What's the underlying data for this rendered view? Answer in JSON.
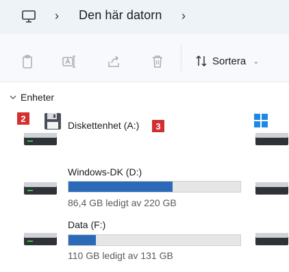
{
  "address": {
    "crumbs": [
      "Den här datorn"
    ],
    "separator": "›"
  },
  "toolbar": {
    "sort_label": "Sortera",
    "buttons": [
      "copy-icon",
      "rename-icon",
      "share-icon",
      "delete-icon"
    ]
  },
  "section": {
    "title": "Enheter"
  },
  "badges": {
    "b2": "2",
    "b3": "3"
  },
  "drives": [
    {
      "name": "Diskettenhet (A:)"
    },
    {
      "name": "Windows-DK (D:)",
      "used_fraction": 0.607,
      "space": "86,4 GB ledigt av 220 GB"
    },
    {
      "name": "Data (F:)",
      "used_fraction": 0.16,
      "space": "110 GB ledigt av 131 GB"
    }
  ],
  "colors": {
    "accent": "#2a6ab8",
    "badge": "#d32f2f",
    "address_bg": "#eef3f8"
  }
}
